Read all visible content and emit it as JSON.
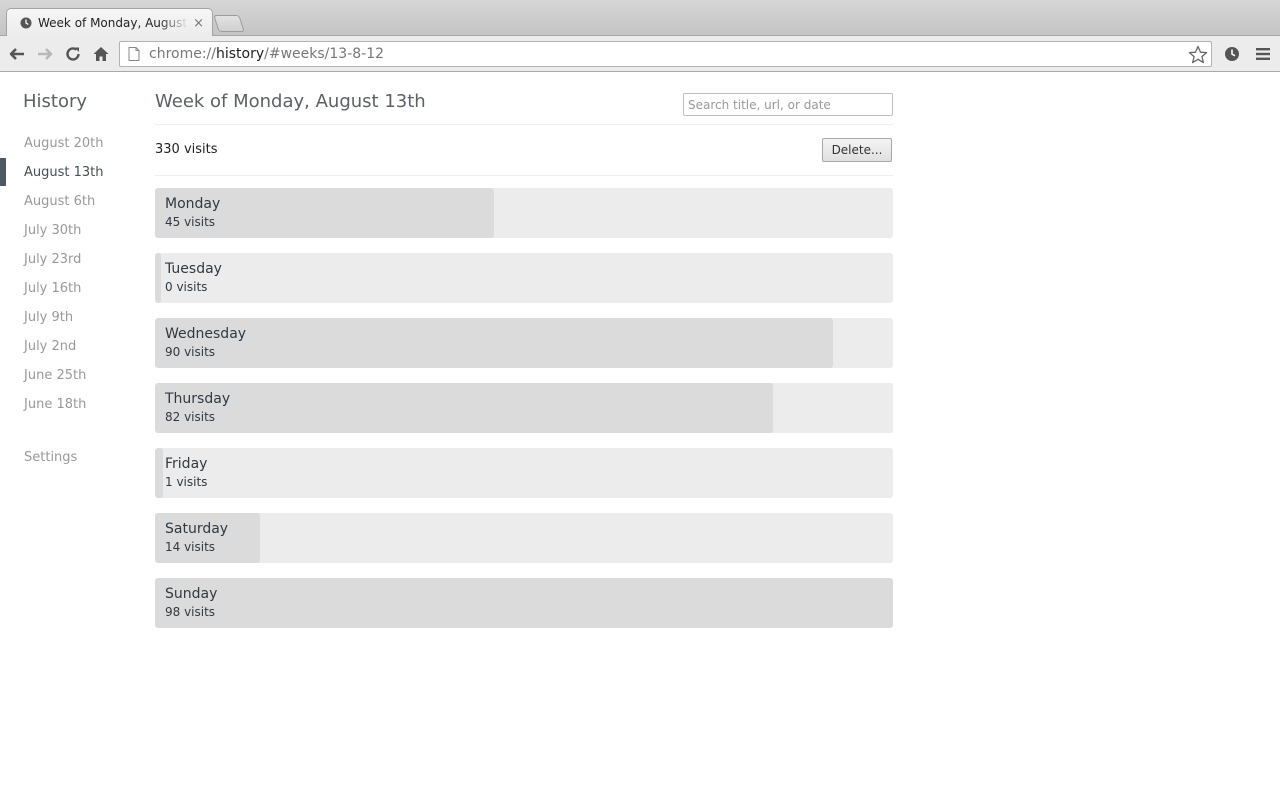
{
  "browser": {
    "tab_title": "Week of Monday, August 13th",
    "tab_close": "×",
    "url_scheme": "chrome://",
    "url_host": "history",
    "url_path": "/#weeks/13-8-12"
  },
  "sidebar": {
    "title": "History",
    "items": [
      {
        "label": "August 20th"
      },
      {
        "label": "August 13th",
        "selected": true
      },
      {
        "label": "August 6th"
      },
      {
        "label": "July 30th"
      },
      {
        "label": "July 23rd"
      },
      {
        "label": "July 16th"
      },
      {
        "label": "July 9th"
      },
      {
        "label": "July 2nd"
      },
      {
        "label": "June 25th"
      },
      {
        "label": "June 18th"
      }
    ],
    "settings_label": "Settings"
  },
  "main": {
    "title": "Week of Monday, August 13th",
    "search_placeholder": "Search title, url, or date",
    "total_visits": "330 visits",
    "delete_label": "Delete...",
    "days": [
      {
        "name": "Monday",
        "visits_label": "45 visits",
        "visits": 45
      },
      {
        "name": "Tuesday",
        "visits_label": "0 visits",
        "visits": 0
      },
      {
        "name": "Wednesday",
        "visits_label": "90 visits",
        "visits": 90
      },
      {
        "name": "Thursday",
        "visits_label": "82 visits",
        "visits": 82
      },
      {
        "name": "Friday",
        "visits_label": "1 visits",
        "visits": 1
      },
      {
        "name": "Saturday",
        "visits_label": "14 visits",
        "visits": 14
      },
      {
        "name": "Sunday",
        "visits_label": "98 visits",
        "visits": 98
      }
    ]
  },
  "colors": {
    "bar_background": "#ececec",
    "bar_fill": "#dbdbdb",
    "selected_indicator": "#4e5764"
  },
  "icons": [
    "clock-icon",
    "back-arrow-icon",
    "forward-arrow-icon",
    "reload-icon",
    "home-icon",
    "page-icon",
    "star-icon",
    "history-clock-icon",
    "menu-icon"
  ]
}
